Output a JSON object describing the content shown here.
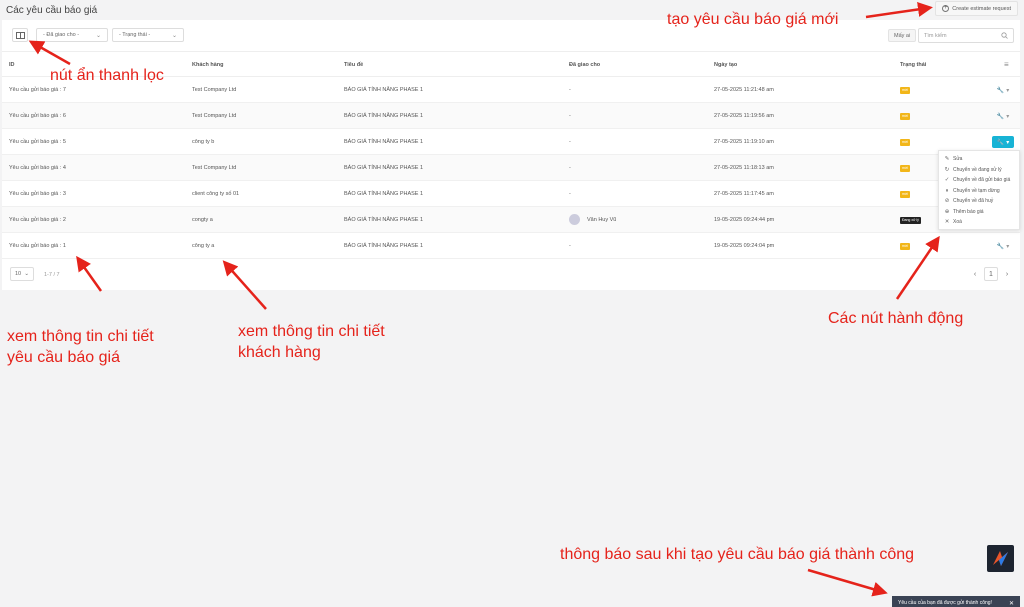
{
  "page": {
    "title": "Các yêu cầu báo giá"
  },
  "toolbar": {
    "create_label": "Create estimate request",
    "assignee_filter": "- Đã giao cho -",
    "status_filter": "- Trạng thái -",
    "mine_label": "Mấy ai",
    "search_placeholder": "Tìm kiếm"
  },
  "table": {
    "columns": [
      "ID",
      "Khách hàng",
      "Tiêu đề",
      "Đã giao cho",
      "Ngày tạo",
      "Trạng thái"
    ],
    "rows": [
      {
        "id": "Yêu cầu gửi báo giá : 7",
        "client": "Test Company Ltd",
        "title": "BÁO GIÁ TÍNH NĂNG PHASE 1",
        "assigned": "-",
        "created": "27-05-2025 11:21:48 am",
        "status": "mới"
      },
      {
        "id": "Yêu cầu gửi báo giá : 6",
        "client": "Test Company Ltd",
        "title": "BÁO GIÁ TÍNH NĂNG PHASE 1",
        "assigned": "-",
        "created": "27-05-2025 11:19:56 am",
        "status": "mới"
      },
      {
        "id": "Yêu cầu gửi báo giá : 5",
        "client": "công ty b",
        "title": "BÁO GIÁ TÍNH NĂNG PHASE 1",
        "assigned": "-",
        "created": "27-05-2025 11:19:10 am",
        "status": "mới"
      },
      {
        "id": "Yêu cầu gửi báo giá : 4",
        "client": "Test Company Ltd",
        "title": "BÁO GIÁ TÍNH NĂNG PHASE 1",
        "assigned": "-",
        "created": "27-05-2025 11:18:13 am",
        "status": "mới"
      },
      {
        "id": "Yêu cầu gửi báo giá : 3",
        "client": "client công ty số 01",
        "title": "BÁO GIÁ TÍNH NĂNG PHASE 1",
        "assigned": "-",
        "created": "27-05-2025 11:17:45 am",
        "status": "mới"
      },
      {
        "id": "Yêu cầu gửi báo giá : 2",
        "client": "congty a",
        "title": "BÁO GIÁ TÍNH NĂNG PHASE 1",
        "assigned": "Văn Huy Vũ",
        "created": "19-05-2025 09:24:44 pm",
        "status": "Đang xử lý"
      },
      {
        "id": "Yêu cầu gửi báo giá : 1",
        "client": "công ty a",
        "title": "BÁO GIÁ TÍNH NĂNG PHASE 1",
        "assigned": "-",
        "created": "19-05-2025 09:24:04 pm",
        "status": "mới"
      }
    ]
  },
  "pagination": {
    "page_size": "10",
    "info": "1-7 / 7",
    "current": "1"
  },
  "action_menu": [
    {
      "icon": "edit-icon",
      "label": "Sửa"
    },
    {
      "icon": "refresh-icon",
      "label": "Chuyển về đang xử lý"
    },
    {
      "icon": "check-circle-icon",
      "label": "Chuyển về đã gửi báo giá"
    },
    {
      "icon": "pause-icon",
      "label": "Chuyển về tạm dừng"
    },
    {
      "icon": "cancel-circle-icon",
      "label": "Chuyển về đã huỷ"
    },
    {
      "icon": "add-circle-icon",
      "label": "Thêm báo giá"
    },
    {
      "icon": "close-icon",
      "label": "Xoá"
    }
  ],
  "annotations": {
    "create": "tạo yêu cầu báo giá mới",
    "filter_toggle": "nút ẩn thanh lọc",
    "request_detail": "xem thông tin chi tiết\nyêu cầu báo giá",
    "client_detail": "xem thông tin chi tiết\nkhách hàng",
    "actions": "Các nút hành động",
    "toast_note": "thông báo sau khi tạo yêu cầu báo giá thành công"
  },
  "toast": {
    "message": "Yêu cầu của bạn đã được gửi thành công!"
  },
  "colors": {
    "accent": "#17b3d5",
    "badge_new": "#f2b619",
    "badge_processing": "#222222",
    "annotation": "#e5231b"
  }
}
